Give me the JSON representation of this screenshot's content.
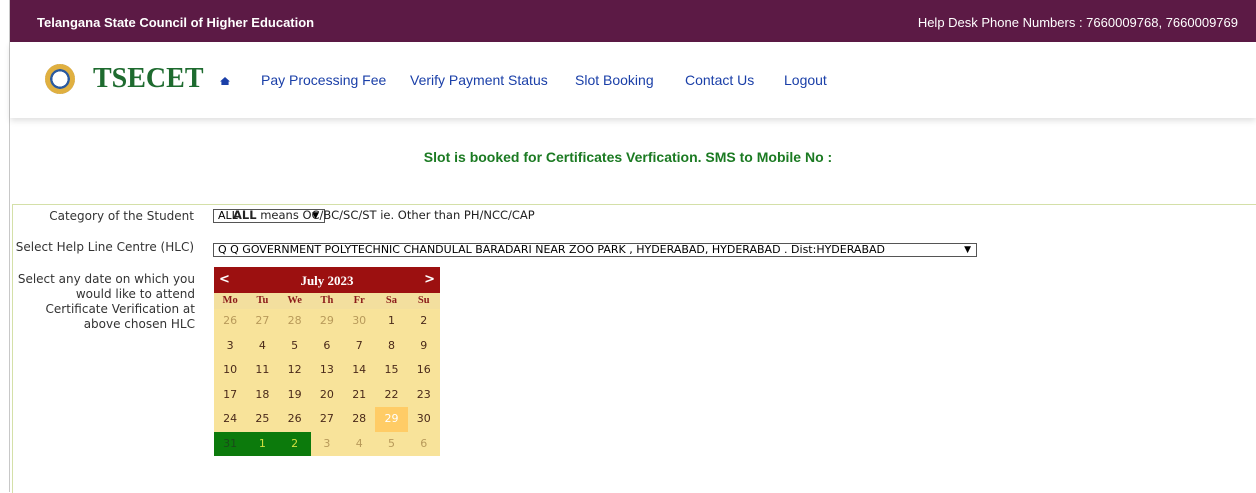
{
  "header": {
    "org_name": "Telangana State Council of Higher Education",
    "helpdesk": "Help Desk Phone Numbers : 7660009768, 7660009769"
  },
  "nav": {
    "brand": "TSECET",
    "items": [
      "Pay Processing Fee",
      "Verify Payment Status",
      "Slot Booking",
      "Contact Us",
      "Logout"
    ]
  },
  "message": "Slot is booked for Certificates Verfication. SMS to Mobile No :",
  "form": {
    "category_label": "Category of the Student",
    "category_value": "ALL",
    "category_note_bold": "ALL",
    "category_note": " means OC/BC/SC/ST ie. Other than PH/NCC/CAP",
    "hlc_label": "Select Help Line Centre (HLC)",
    "hlc_value": "Q Q GOVERNMENT POLYTECHNIC CHANDULAL BARADARI NEAR ZOO PARK , HYDERABAD, HYDERABAD . Dist:HYDERABAD",
    "date_label": "Select any date on which you would like to attend Certificate Verification at above chosen HLC"
  },
  "calendar": {
    "month_title": "July 2023",
    "prev": "<",
    "next": ">",
    "weekdays": [
      "Mo",
      "Tu",
      "We",
      "Th",
      "Fr",
      "Sa",
      "Su"
    ],
    "weeks": [
      [
        "26",
        "27",
        "28",
        "29",
        "30",
        "1",
        "2"
      ],
      [
        "3",
        "4",
        "5",
        "6",
        "7",
        "8",
        "9"
      ],
      [
        "10",
        "11",
        "12",
        "13",
        "14",
        "15",
        "16"
      ],
      [
        "17",
        "18",
        "19",
        "20",
        "21",
        "22",
        "23"
      ],
      [
        "24",
        "25",
        "26",
        "27",
        "28",
        "29",
        "30"
      ],
      [
        "31",
        "1",
        "2",
        "3",
        "4",
        "5",
        "6"
      ]
    ],
    "today": "29",
    "colors": {
      "header": "#9c1010",
      "today": "#ffcc66",
      "selected": "#0c7a0c"
    }
  }
}
